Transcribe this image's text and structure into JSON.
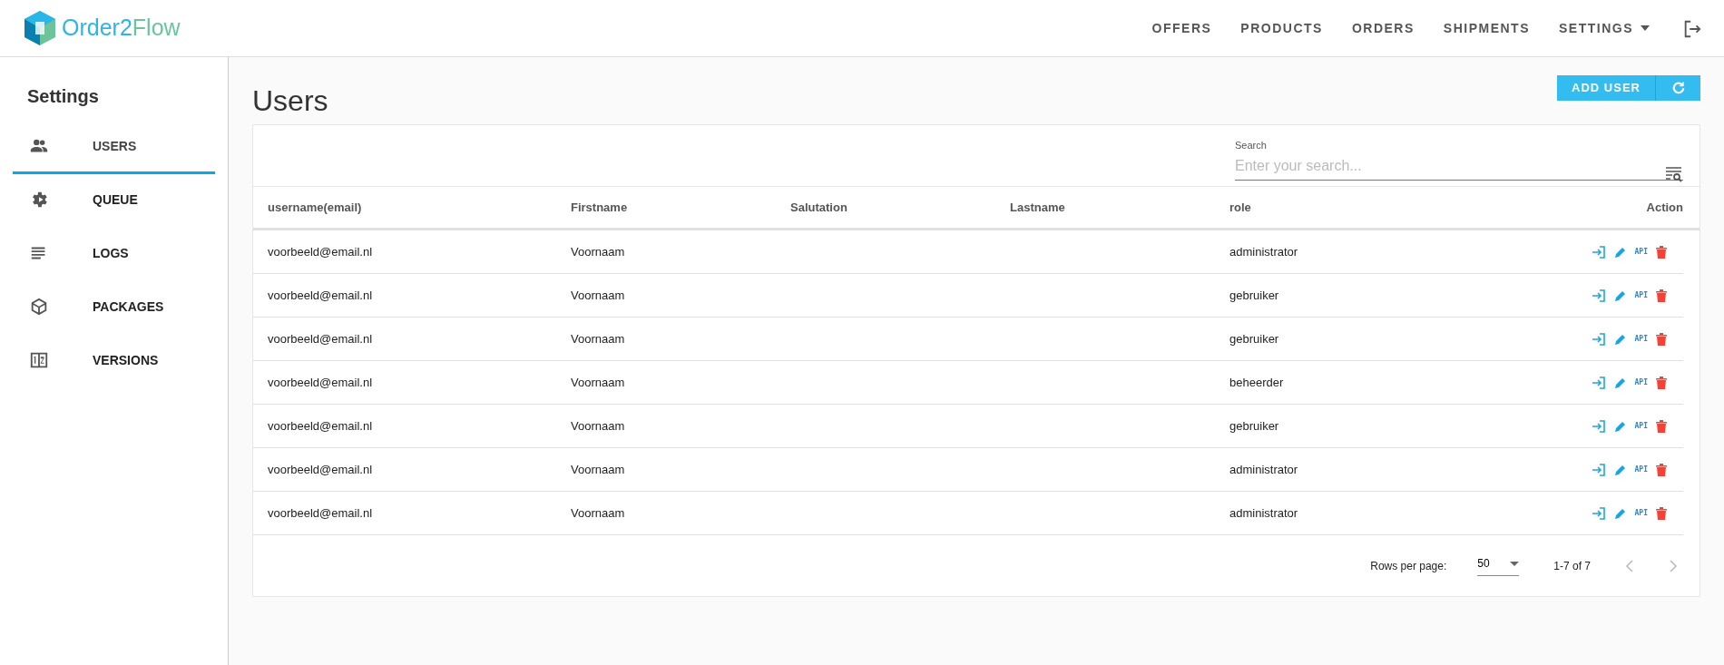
{
  "brand": {
    "name_part1": "Order2",
    "name_part2": "Flow"
  },
  "nav": [
    {
      "label": "OFFERS",
      "kind": "link"
    },
    {
      "label": "PRODUCTS",
      "kind": "link"
    },
    {
      "label": "ORDERS",
      "kind": "link"
    },
    {
      "label": "SHIPMENTS",
      "kind": "link"
    },
    {
      "label": "SETTINGS",
      "kind": "dropdown"
    }
  ],
  "sidebar": {
    "title": "Settings",
    "items": [
      {
        "label": "USERS",
        "selected": true
      },
      {
        "label": "QUEUE",
        "selected": false
      },
      {
        "label": "LOGS",
        "selected": false
      },
      {
        "label": "PACKAGES",
        "selected": false
      },
      {
        "label": "VERSIONS",
        "selected": false
      }
    ]
  },
  "page_title": "Users",
  "buttons": {
    "add": "ADD USER"
  },
  "search": {
    "label": "Search",
    "placeholder": "Enter your search..."
  },
  "table": {
    "columns": [
      "username(email)",
      "Firstname",
      "Salutation",
      "Lastname",
      "role",
      "Action"
    ],
    "rows": [
      {
        "cells": [
          "voorbeeld@email.nl",
          "Voornaam",
          "",
          "",
          "administrator"
        ],
        "api_label": "API"
      },
      {
        "cells": [
          "voorbeeld@email.nl",
          "Voornaam",
          "",
          "",
          "gebruiker"
        ],
        "api_label": "API"
      },
      {
        "cells": [
          "voorbeeld@email.nl",
          "Voornaam",
          "",
          "",
          "gebruiker"
        ],
        "api_label": "API"
      },
      {
        "cells": [
          "voorbeeld@email.nl",
          "Voornaam",
          "",
          "",
          "beheerder"
        ],
        "api_label": "API"
      },
      {
        "cells": [
          "voorbeeld@email.nl",
          "Voornaam",
          "",
          "",
          "gebruiker"
        ],
        "api_label": "API"
      },
      {
        "cells": [
          "voorbeeld@email.nl",
          "Voornaam",
          "",
          "",
          "administrator"
        ],
        "api_label": "API"
      },
      {
        "cells": [
          "voorbeeld@email.nl",
          "Voornaam",
          "",
          "",
          "administrator"
        ],
        "api_label": "API"
      }
    ]
  },
  "pagination": {
    "rows_per_page_label": "Rows per page:",
    "rows_per_page": "50",
    "range": "1-7 of 7",
    "prev_disabled": true,
    "next_disabled": true
  }
}
